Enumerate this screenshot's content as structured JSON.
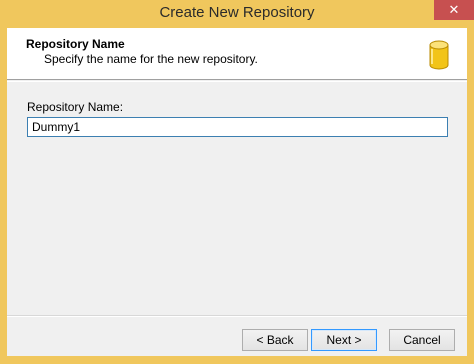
{
  "window": {
    "title": "Create New Repository",
    "close_label": "✕"
  },
  "header": {
    "title": "Repository Name",
    "subtitle": "Specify the name for the new repository.",
    "icon": "database-icon"
  },
  "form": {
    "name_label": "Repository Name:",
    "name_value": "Dummy1"
  },
  "buttons": {
    "back": "< Back",
    "next": "Next >",
    "cancel": "Cancel"
  },
  "colors": {
    "frame": "#f0c75d",
    "close": "#c75050",
    "input_border": "#3c7fb1",
    "icon_gold": "#f2c418"
  }
}
